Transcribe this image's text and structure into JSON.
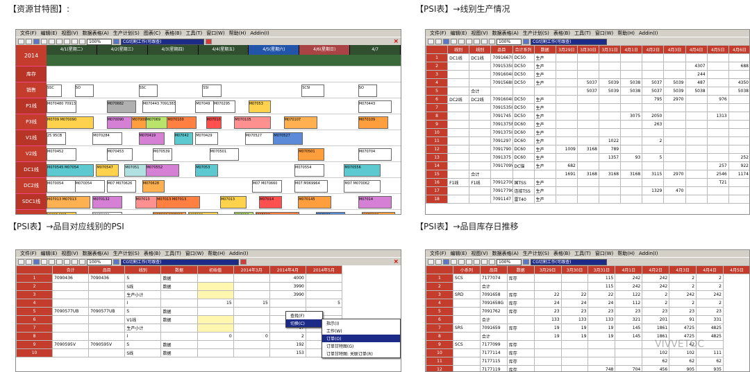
{
  "captions": {
    "tl": "【资源甘特图】:",
    "tr": "【PSI表】→线别生产情况",
    "bl": "【PSI表】→品目对应线别的PSI",
    "br": "【PSI表】→品目库存日推移"
  },
  "menu": {
    "items": [
      "文件(F)",
      "编辑(E)",
      "视图(V)",
      "数据表格(A)",
      "生产计划(S)",
      "图表(C)",
      "表格(B)",
      "工具(T)",
      "窗口(W)",
      "帮助(H)",
      "Addin(I)"
    ],
    "items_short": [
      "文件(F)",
      "编辑(E)",
      "视图(V)",
      "数据表格(A)",
      "生产计划(S)",
      "表格(B)",
      "工具(T)",
      "窗口(W)",
      "帮助(H)",
      "Addin(I)"
    ]
  },
  "toolbar": {
    "zoom": "100%",
    "plan_combo": "CG切割工作(可跟查)"
  },
  "gantt": {
    "year": "2014",
    "days": [
      "4/1(星期二)",
      "4/2(星期三)",
      "4/3(星期四)",
      "4/4(星期五)",
      "4/5(星期六)",
      "4/6(星期日)",
      "4/7"
    ],
    "lines": [
      "库存",
      "销售",
      "P1线",
      "P3线",
      "V1线",
      "V2线",
      "DC1线",
      "DC2线",
      "SDC1线",
      "SDC2线",
      "F线"
    ],
    "lanes": [
      [],
      [
        {
          "t": "SSC",
          "s": 0,
          "w": 4,
          "c": "#ffffff"
        },
        {
          "t": "SO",
          "s": 8,
          "w": 5,
          "c": "#ffffff"
        },
        {
          "t": "SSC",
          "s": 26,
          "w": 5,
          "c": "#ffffff"
        },
        {
          "t": "SSI",
          "s": 44,
          "w": 5,
          "c": "#ffffff"
        },
        {
          "t": "SCSI",
          "s": 72,
          "w": 6,
          "c": "#ffffff"
        },
        {
          "t": "SO",
          "s": 88,
          "w": 5,
          "c": "#ffffff"
        }
      ],
      [
        {
          "t": "M070480 7091383C",
          "s": 0,
          "w": 8,
          "c": "#ffffff"
        },
        {
          "t": "M070682",
          "s": 17,
          "w": 8,
          "c": "#b0b0b0"
        },
        {
          "t": "M070443 7091383C",
          "s": 27,
          "w": 9,
          "c": "#ffffff"
        },
        {
          "t": "M07049",
          "s": 42,
          "w": 5,
          "c": "#ffffff"
        },
        {
          "t": "M070295",
          "s": 47,
          "w": 6,
          "c": "#ffffff"
        },
        {
          "t": "M07053",
          "s": 57,
          "w": 6,
          "c": "#ffd24d"
        },
        {
          "t": "M070443",
          "s": 88,
          "w": 9,
          "c": "#ffffff"
        }
      ],
      [
        {
          "t": "M0709 M070090",
          "s": 0,
          "w": 13,
          "c": "#ffd24d"
        },
        {
          "t": "M070090",
          "s": 17,
          "w": 7,
          "c": "#d580d5"
        },
        {
          "t": "M07009",
          "s": 24,
          "w": 4,
          "c": "#ff9e3d"
        },
        {
          "t": "M07069",
          "s": 28,
          "w": 6,
          "c": "#b9e36b"
        },
        {
          "t": "M070100",
          "s": 34,
          "w": 8,
          "c": "#ff8040"
        },
        {
          "t": "M07010",
          "s": 45,
          "w": 4,
          "c": "#ff5050"
        },
        {
          "t": "M070105",
          "s": 53,
          "w": 10,
          "c": "#ff9090"
        },
        {
          "t": "M070107",
          "s": 67,
          "w": 9,
          "c": "#ffb050"
        },
        {
          "t": "M070109",
          "s": 88,
          "w": 8,
          "c": "#ff9e3d"
        }
      ],
      [
        {
          "t": "25 95CB",
          "s": 0,
          "w": 5,
          "c": "#ffffff"
        },
        {
          "t": "M070284",
          "s": 13,
          "w": 8,
          "c": "#ffffff"
        },
        {
          "t": "M070419",
          "s": 26,
          "w": 7,
          "c": "#d580d5"
        },
        {
          "t": "M07042",
          "s": 36,
          "w": 5,
          "c": "#5cc8d0"
        },
        {
          "t": "M070429",
          "s": 42,
          "w": 6,
          "c": "#ffffff"
        },
        {
          "t": "M070527",
          "s": 56,
          "w": 8,
          "c": "#ffffff"
        },
        {
          "t": "M070527",
          "s": 64,
          "w": 8,
          "c": "#5a8ad8"
        }
      ],
      [
        {
          "t": "M070452",
          "s": 0,
          "w": 8,
          "c": "#ffffff"
        },
        {
          "t": "M070453",
          "s": 17,
          "w": 7,
          "c": "#ffffff"
        },
        {
          "t": "M070539",
          "s": 30,
          "w": 5,
          "c": "#ffffff"
        },
        {
          "t": "M070501",
          "s": 46,
          "w": 8,
          "c": "#ffffff"
        },
        {
          "t": "M070501",
          "s": 71,
          "w": 7,
          "c": "#ff9e3d"
        },
        {
          "t": "M070704",
          "s": 88,
          "w": 9,
          "c": "#ffffff"
        }
      ],
      [
        {
          "t": "M070545 M07054",
          "s": 0,
          "w": 13,
          "c": "#5cc8d0"
        },
        {
          "t": "M070547",
          "s": 14,
          "w": 6,
          "c": "#ffd24d"
        },
        {
          "t": "M07051",
          "s": 22,
          "w": 6,
          "c": "#b0e0e0"
        },
        {
          "t": "M070552",
          "s": 28,
          "w": 9,
          "c": "#d580d5"
        },
        {
          "t": "M07053",
          "s": 42,
          "w": 6,
          "c": "#5cc8d0"
        },
        {
          "t": "M070554",
          "s": 70,
          "w": 8,
          "c": "#ffffff"
        },
        {
          "t": "M070556",
          "s": 84,
          "w": 10,
          "c": "#5cc8d0"
        }
      ],
      [
        {
          "t": "M070054",
          "s": 0,
          "w": 8,
          "c": "#ffffff"
        },
        {
          "t": "M070054",
          "s": 8,
          "w": 8,
          "c": "#ffffff"
        },
        {
          "t": "M07 M070626",
          "s": 17,
          "w": 8,
          "c": "#ffffff"
        },
        {
          "t": "M070628",
          "s": 27,
          "w": 6,
          "c": "#ffb050"
        },
        {
          "t": "M07 M070660",
          "s": 58,
          "w": 8,
          "c": "#ffffff"
        },
        {
          "t": "M07 M069964",
          "s": 70,
          "w": 9,
          "c": "#ffffff"
        },
        {
          "t": "M07 M070062",
          "s": 84,
          "w": 10,
          "c": "#ffffff"
        }
      ],
      [
        {
          "t": "M07013 M07013",
          "s": 0,
          "w": 12,
          "c": "#ffb050"
        },
        {
          "t": "M070132",
          "s": 13,
          "w": 8,
          "c": "#d580d5"
        },
        {
          "t": "M07013",
          "s": 25,
          "w": 6,
          "c": "#ff9090"
        },
        {
          "t": "M07013 M07013",
          "s": 31,
          "w": 12,
          "c": "#ff8040"
        },
        {
          "t": "M07013",
          "s": 49,
          "w": 7,
          "c": "#ffd24d"
        },
        {
          "t": "M07014",
          "s": 60,
          "w": 6,
          "c": "#ff5050"
        },
        {
          "t": "M070145",
          "s": 71,
          "w": 9,
          "c": "#ff9e3d"
        },
        {
          "t": "M07014",
          "s": 88,
          "w": 9,
          "c": "#d580d5"
        }
      ],
      [
        {
          "t": "MM07 M07",
          "s": 0,
          "w": 8,
          "c": "#ffd24d"
        },
        {
          "t": "M070201",
          "s": 13,
          "w": 8,
          "c": "#ffffff"
        },
        {
          "t": "M07002 M07002",
          "s": 30,
          "w": 9,
          "c": "#ff9e3d"
        },
        {
          "t": "M07002",
          "s": 40,
          "w": 8,
          "c": "#ffd24d"
        },
        {
          "t": "M07020",
          "s": 53,
          "w": 5,
          "c": "#b9e36b"
        },
        {
          "t": "M07020",
          "s": 59,
          "w": 12,
          "c": "#ff8040"
        },
        {
          "t": "M07020",
          "s": 76,
          "w": 8,
          "c": "#5a8ad8"
        },
        {
          "t": "M070032",
          "s": 89,
          "w": 9,
          "c": "#ff9e3d"
        }
      ],
      [
        {
          "t": "047 66",
          "s": 0,
          "w": 5,
          "c": "#ffffff"
        },
        {
          "t": "M07004",
          "s": 13,
          "w": 8,
          "c": "#d580d5"
        },
        {
          "t": "M07036",
          "s": 22,
          "w": 6,
          "c": "#ffffff"
        },
        {
          "t": "M07078",
          "s": 37,
          "w": 8,
          "c": "#ffffff"
        },
        {
          "t": "M07 M07030",
          "s": 46,
          "w": 10,
          "c": "#ffffff"
        },
        {
          "t": "M069 M0700",
          "s": 70,
          "w": 9,
          "c": "#ffffff"
        },
        {
          "t": "M07026",
          "s": 89,
          "w": 9,
          "c": "#ffffff"
        }
      ]
    ]
  },
  "line_psi": {
    "headers": [
      "线别",
      "线别",
      "品目",
      "合计系列",
      "数据",
      "3月29日",
      "3月30日",
      "3月31日",
      "4月1日",
      "4月2日",
      "4月3日",
      "4月4日",
      "4月5日",
      "4月6日"
    ],
    "rows": [
      [
        "DC1线",
        "DC1线",
        "7091667I",
        "DC50",
        "生产",
        "",
        "",
        "",
        "",
        "",
        "",
        "",
        "",
        ""
      ],
      [
        "",
        "",
        "7091535I",
        "DC50",
        "生产",
        "",
        "",
        "",
        "",
        "",
        "",
        "4307",
        "",
        "688"
      ],
      [
        "",
        "",
        "7091604I",
        "DC50",
        "生产",
        "",
        "",
        "",
        "",
        "",
        "",
        "244",
        "",
        ""
      ],
      [
        "",
        "",
        "7091568I",
        "DC50",
        "生产",
        "",
        "5037",
        "5039",
        "5038",
        "5037",
        "5039",
        "487",
        "",
        "4350"
      ],
      [
        "",
        "合计",
        "",
        "",
        "",
        "",
        "5037",
        "5039",
        "5038",
        "5037",
        "5039",
        "5038",
        "",
        "5038"
      ],
      [
        "DC2线",
        "DC2线",
        "7091604I",
        "DC50",
        "生产",
        "",
        "",
        "",
        "",
        "795",
        "2970",
        "",
        "976",
        ""
      ],
      [
        "",
        "",
        "7091535I",
        "DC50",
        "生产",
        "",
        "",
        "",
        "",
        "",
        "",
        "",
        "",
        ""
      ],
      [
        "",
        "",
        "7091745",
        "DC50",
        "生产",
        "",
        "",
        "",
        "3075",
        "2050",
        "",
        "",
        "1313",
        ""
      ],
      [
        "",
        "",
        "7091375P",
        "DC60",
        "生产",
        "",
        "",
        "",
        "",
        "263",
        "",
        "",
        "",
        ""
      ],
      [
        "",
        "",
        "7091375I",
        "DC60",
        "生产",
        "",
        "",
        "",
        "",
        "",
        "",
        "",
        "",
        ""
      ],
      [
        "",
        "",
        "7091297",
        "DC60",
        "生产",
        "",
        "",
        "1022",
        "",
        "2",
        "",
        "",
        "",
        ""
      ],
      [
        "",
        "",
        "7091790",
        "DC60",
        "生产",
        "1009",
        "3168",
        "789",
        "",
        "",
        "",
        "",
        "",
        ""
      ],
      [
        "",
        "",
        "7091375",
        "DC60",
        "生产",
        "",
        "",
        "1357",
        "93",
        "5",
        "",
        "",
        "",
        "252"
      ],
      [
        "",
        "",
        "7091709V",
        "DC锚",
        "生产",
        "682",
        "",
        "",
        "",
        "",
        "",
        "",
        "257",
        "922"
      ],
      [
        "",
        "合计",
        "",
        "",
        "",
        "1691",
        "3168",
        "3168",
        "3168",
        "3115",
        "2970",
        "",
        "2546",
        "1174"
      ],
      [
        "F1线",
        "F1线",
        "7091270C",
        "国TSS",
        "生产",
        "",
        "",
        "",
        "",
        "",
        "",
        "",
        "T21",
        ""
      ],
      [
        "",
        "",
        "7091779C",
        "连接TSS",
        "生产",
        "",
        "",
        "",
        "",
        "1329",
        "470",
        "",
        "",
        ""
      ],
      [
        "",
        "",
        "7091147",
        "雷T40",
        "生产",
        "",
        "",
        "",
        "",
        "",
        "",
        "",
        "",
        ""
      ]
    ]
  },
  "item_psi": {
    "headers": [
      "合计",
      "品目",
      "线别",
      "数据",
      "初始值",
      "2014年3月",
      "2014年4月",
      "2014年5月"
    ],
    "rows": [
      [
        "7090436",
        "7090436",
        "S",
        "数据",
        "",
        "",
        "4000",
        ""
      ],
      [
        "",
        "",
        "S线",
        "数据",
        "",
        "",
        "3990",
        ""
      ],
      [
        "",
        "",
        "生产小计",
        "",
        "",
        "",
        "3990",
        ""
      ],
      [
        "",
        "",
        "I",
        "",
        "15",
        "15",
        "",
        "5"
      ],
      [
        "7090577UB",
        "7090577UB",
        "S",
        "数据",
        "",
        "",
        "",
        ""
      ],
      [
        "",
        "",
        "V1线",
        "数据",
        "",
        "",
        "17",
        ""
      ],
      [
        "",
        "",
        "生产小计",
        "",
        "",
        "",
        "17",
        ""
      ],
      [
        "",
        "",
        "I",
        "",
        "0",
        "0",
        "2",
        "2"
      ],
      [
        "7090595V",
        "7090595V",
        "S",
        "数据",
        "",
        "",
        "192",
        ""
      ],
      [
        "",
        "",
        "S线",
        "数据",
        "",
        "",
        "153",
        ""
      ]
    ],
    "context_menu": {
      "items": [
        "查找(F)",
        "切换(C)"
      ],
      "submenu": [
        "指示(I)",
        "工作(W)",
        "订单(O)",
        "订单甘特图(G)",
        "订单甘特图: 关联订单(R)"
      ]
    }
  },
  "stock": {
    "headers": [
      "小系列",
      "品目",
      "数据",
      "3月29日",
      "3月30日",
      "3月31日",
      "4月1日",
      "4月2日",
      "4月3日",
      "4月4日",
      "4月5日"
    ],
    "rows": [
      [
        "SCS",
        "7177074",
        "库存",
        "",
        "",
        "115",
        "242",
        "242",
        "2",
        "2"
      ],
      [
        "",
        "合计",
        "",
        "",
        "",
        "115",
        "242",
        "242",
        "2",
        "2"
      ],
      [
        "SRD",
        "7091658",
        "库存",
        "22",
        "22",
        "22",
        "122",
        "2",
        "242",
        "242"
      ],
      [
        "",
        "7091658G",
        "库存",
        "24",
        "24",
        "24",
        "112",
        "2",
        "2",
        "2"
      ],
      [
        "",
        "7091762",
        "库存",
        "23",
        "23",
        "23",
        "23",
        "23",
        "23",
        "23"
      ],
      [
        "",
        "合计",
        "",
        "133",
        "133",
        "133",
        "321",
        "201",
        "91",
        "331"
      ],
      [
        "SRS",
        "7091659",
        "库存",
        "19",
        "19",
        "19",
        "145",
        "1861",
        "4725",
        "4825"
      ],
      [
        "",
        "合计",
        "",
        "19",
        "19",
        "19",
        "145",
        "1861",
        "4725",
        "4825"
      ],
      [
        "SCS",
        "7177099",
        "库存",
        "",
        "",
        "",
        "",
        "",
        "42",
        ""
      ],
      [
        "",
        "7177114",
        "库存",
        "",
        "",
        "",
        "",
        "102",
        "102",
        "111"
      ],
      [
        "",
        "7177115",
        "库存",
        "",
        "",
        "",
        "",
        "62",
        "62",
        "62"
      ],
      [
        "",
        "7177119",
        "库存",
        "",
        "",
        "748",
        "704",
        "456",
        "905",
        "935"
      ]
    ]
  },
  "watermark": "VIVVETOC"
}
